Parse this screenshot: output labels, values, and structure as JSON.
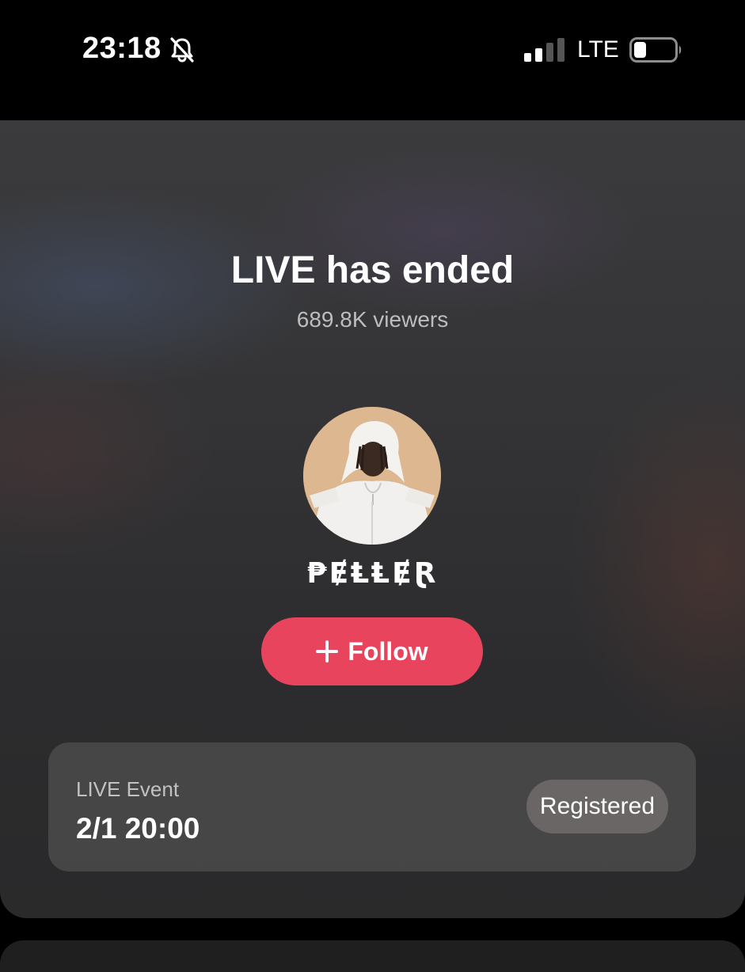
{
  "status_bar": {
    "time": "23:18",
    "network": "LTE",
    "signal_bars": 2,
    "signal_bars_total": 4,
    "battery_level": 0.25,
    "icons": [
      "bell-slash-icon",
      "signal-icon",
      "battery-icon"
    ]
  },
  "live": {
    "title": "LIVE has ended",
    "viewers": "689.8K viewers",
    "host_name": "₱ɆⱠⱠɆⱤ",
    "follow_label": "Follow",
    "follow_icon": "plus-icon"
  },
  "event": {
    "label": "LIVE Event",
    "time": "2/1 20:00",
    "status_label": "Registered"
  },
  "colors": {
    "follow_button": "#e9445d",
    "background": "#000000",
    "card": "#333335"
  }
}
